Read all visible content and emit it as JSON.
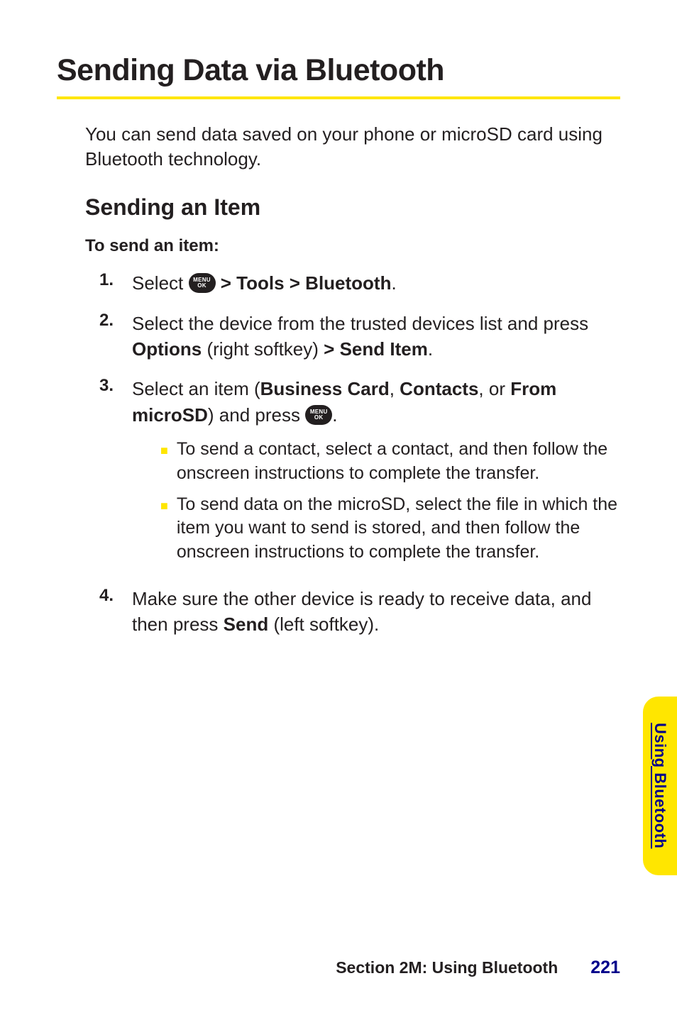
{
  "title": "Sending Data via Bluetooth",
  "intro": "You can send data saved on your phone or microSD card using Bluetooth technology.",
  "subheading": "Sending an Item",
  "lead": "To send an item:",
  "menu_icon": {
    "top": "MENU",
    "bottom": "OK"
  },
  "steps": {
    "s1": {
      "num": "1.",
      "pre": "Select ",
      "post": " > Tools > Bluetooth",
      "end": "."
    },
    "s2": {
      "num": "2.",
      "a": "Select the device from the trusted devices list and press ",
      "b": "Options",
      "c": " (right softkey) ",
      "d": "> Send Item",
      "e": "."
    },
    "s3": {
      "num": "3.",
      "a": "Select an item (",
      "b": "Business Card",
      "c": ", ",
      "d": "Contacts",
      "e": ", or ",
      "f": "From microSD",
      "g": ") and press ",
      "h": ".",
      "bullets": {
        "b1": "To send a contact, select a contact, and then follow the onscreen instructions to complete the transfer.",
        "b2": "To send data on the microSD, select the file in which the item you want to send is stored, and then follow the onscreen instructions to complete the transfer."
      }
    },
    "s4": {
      "num": "4.",
      "a": "Make sure the other device is ready to receive data, and then press ",
      "b": "Send",
      "c": " (left softkey)."
    }
  },
  "side_tab": "Using Bluetooth",
  "footer": {
    "section": "Section 2M: Using Bluetooth",
    "page": "221"
  }
}
